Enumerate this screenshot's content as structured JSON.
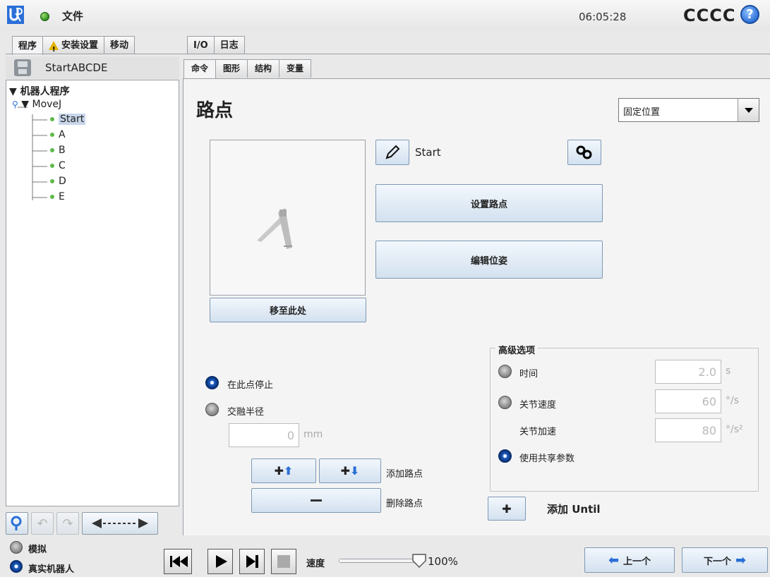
{
  "header": {
    "file_menu": "文件",
    "clock": "06:05:28",
    "robot_name": "CCCC",
    "help": "?"
  },
  "main_tabs": [
    {
      "label": "程序",
      "active": true
    },
    {
      "label": "安装设置",
      "active": false,
      "icon": "warning-icon"
    },
    {
      "label": "移动",
      "active": false
    },
    {
      "label": "I/O",
      "active": false
    },
    {
      "label": "日志",
      "active": false
    }
  ],
  "program": {
    "name": "StartABCDE",
    "tree": {
      "root": "机器人程序",
      "movej": "MoveJ",
      "waypoints": [
        "Start",
        "A",
        "B",
        "C",
        "D",
        "E"
      ],
      "selected": "Start"
    }
  },
  "sub_tabs": [
    {
      "label": "命令",
      "active": true
    },
    {
      "label": "图形",
      "active": false
    },
    {
      "label": "结构",
      "active": false
    },
    {
      "label": "变量",
      "active": false
    }
  ],
  "waypoint_panel": {
    "title": "路点",
    "position_type": "固定位置",
    "waypoint_name": "Start",
    "set_waypoint": "设置路点",
    "edit_pose": "编辑位姿",
    "move_here": "移至此处",
    "stop_at_point": "在此点停止",
    "blend_radius": "交融半径",
    "blend_value": "0",
    "blend_unit": "mm",
    "add_waypoint": "添加路点",
    "remove_waypoint": "删除路点",
    "add_until_plus": "✚",
    "add_until": "添加 Until"
  },
  "advanced": {
    "title": "高级选项",
    "time_label": "时间",
    "time_value": "2.0",
    "time_unit": "s",
    "joint_speed_label": "关节速度",
    "joint_speed_value": "60",
    "joint_speed_unit": "°/s",
    "joint_accel_label": "关节加速",
    "joint_accel_value": "80",
    "joint_accel_unit": "°/s²",
    "shared_params_label": "使用共享参数",
    "selected": "shared"
  },
  "footer": {
    "simulation": "模拟",
    "real_robot": "真实机器人",
    "mode": "real",
    "speed_label": "速度",
    "speed_value": "100%",
    "speed_fraction": 1.0,
    "prev": "上一个",
    "next": "下一个"
  },
  "colors": {
    "accent_blue": "#1f63c9",
    "status_green": "#2e8b1f",
    "warning_yellow": "#e3b300"
  }
}
